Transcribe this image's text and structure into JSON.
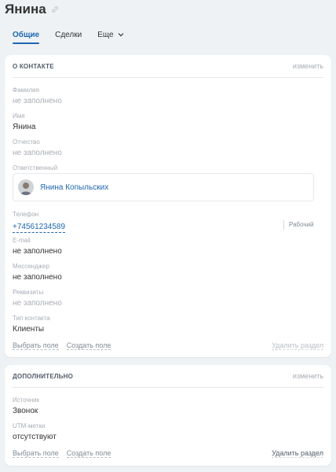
{
  "header": {
    "title": "Янина",
    "link_icon": "link-icon"
  },
  "tabs": [
    {
      "label": "Общие",
      "active": true
    },
    {
      "label": "Сделки",
      "active": false
    },
    {
      "label": "Еще",
      "active": false
    }
  ],
  "about": {
    "title": "О КОНТАКТЕ",
    "edit": "изменить",
    "fields": {
      "last_name": {
        "label": "Фамилия",
        "value": "не заполнено"
      },
      "first_name": {
        "label": "Имя",
        "value": "Янина"
      },
      "middle_name": {
        "label": "Отчество",
        "value": "не заполнено"
      },
      "responsible": {
        "label": "Ответственный",
        "value": "Янина Копыльских"
      },
      "phone": {
        "label": "Телефон",
        "value": "+74561234589",
        "type": "Рабочий"
      },
      "email": {
        "label": "E-mail",
        "value": "не заполнено"
      },
      "messenger": {
        "label": "Мессенджер",
        "value": "не заполнено"
      },
      "requisites": {
        "label": "Реквизиты",
        "value": "не заполнено"
      },
      "contact_type": {
        "label": "Тип контакта",
        "value": "Клиенты"
      }
    },
    "footer": {
      "select_field": "Выбрать поле",
      "create_field": "Создать поле",
      "delete_section": "Удалить раздел"
    }
  },
  "additional": {
    "title": "ДОПОЛНИТЕЛЬНО",
    "edit": "изменить",
    "fields": {
      "source": {
        "label": "Источник",
        "value": "Звонок"
      },
      "utm": {
        "label": "UTM-метки",
        "value": "отсутствуют"
      }
    },
    "footer": {
      "select_field": "Выбрать поле",
      "create_field": "Создать поле",
      "delete_section": "Удалить раздел"
    }
  },
  "colors": {
    "accent": "#2067b0",
    "muted": "#a8adb4",
    "background": "#eef2f4"
  }
}
